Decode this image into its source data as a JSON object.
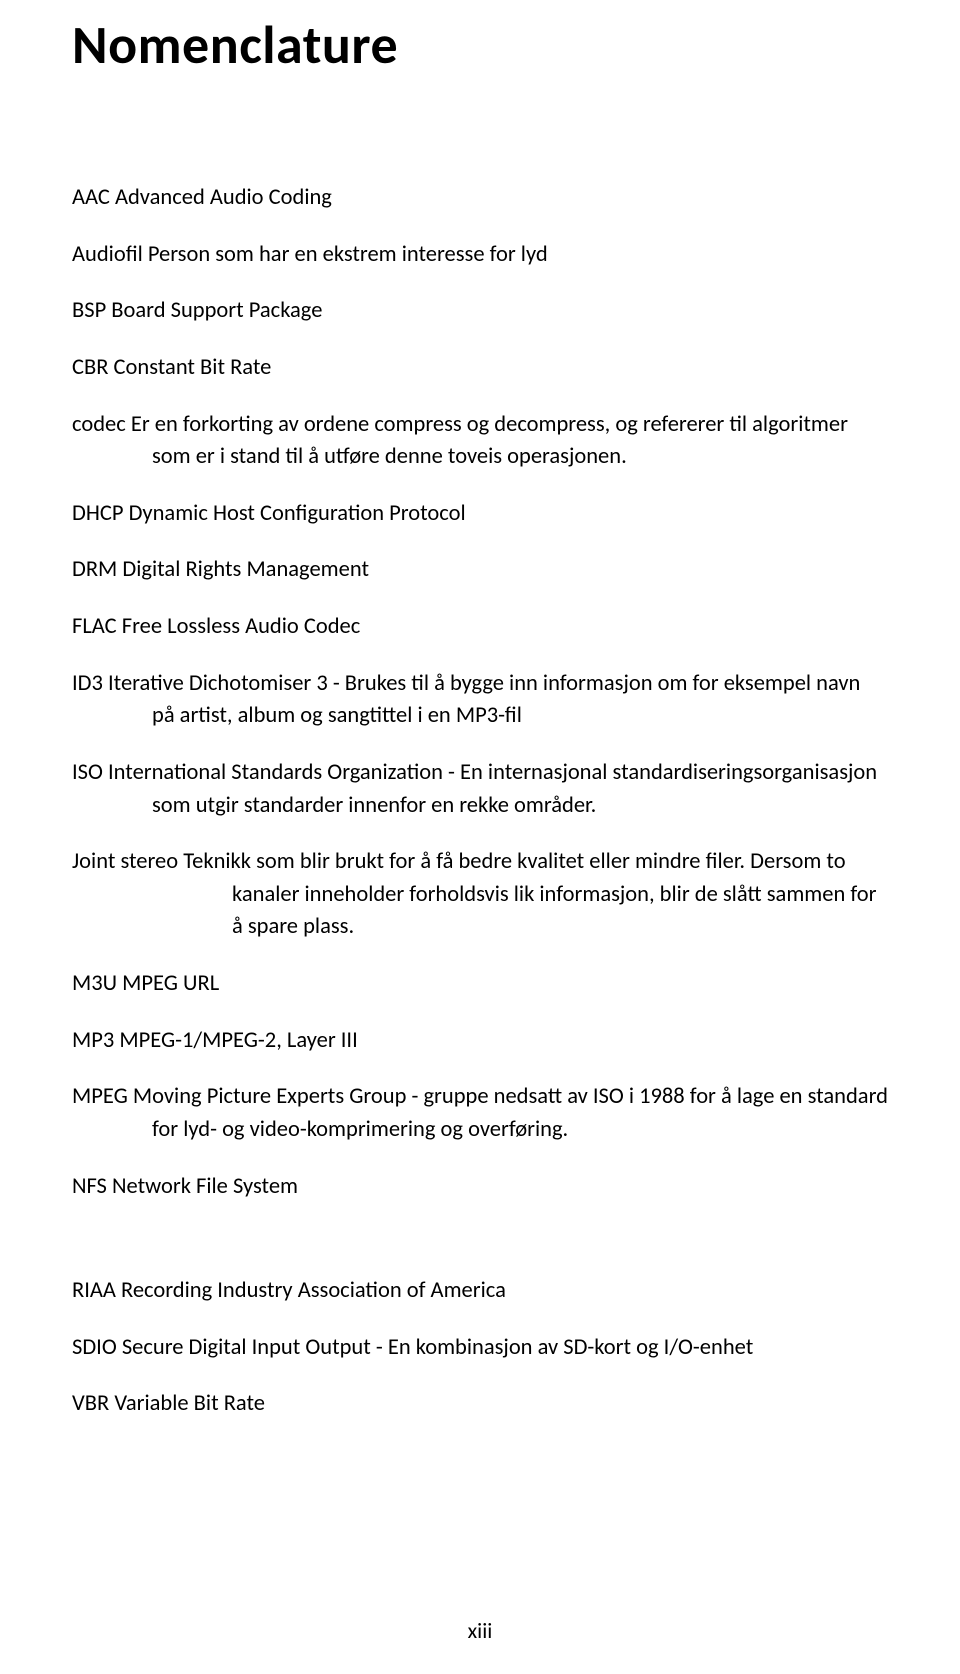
{
  "title": "Nomenclature",
  "page_number": "xiii",
  "entries": [
    {
      "term": "AAC",
      "sep": "   ",
      "def": "Advanced Audio Coding",
      "wide": false
    },
    {
      "term": "Audiofil",
      "sep": " ",
      "def": "Person som har en ekstrem interesse for lyd",
      "wide": true
    },
    {
      "term": "BSP",
      "sep": "   ",
      "def": "Board Support Package",
      "wide": false
    },
    {
      "term": "CBR",
      "sep": "   ",
      "def": "Constant Bit Rate",
      "wide": false
    },
    {
      "term": "codec",
      "sep": "  ",
      "def": "Er en forkorting av ordene compress og decompress, og refererer til algoritmer som er i stand til å utføre denne toveis operasjonen.",
      "wide": false
    },
    {
      "term": "DHCP",
      "sep": " ",
      "def": "Dynamic Host Configuration Protocol",
      "wide": false
    },
    {
      "term": "DRM",
      "sep": "   ",
      "def": "Digital Rights Management",
      "wide": false
    },
    {
      "term": "FLAC",
      "sep": "  ",
      "def": "Free Lossless Audio Codec",
      "wide": false
    },
    {
      "term": "ID3",
      "sep": "    ",
      "def": "Iterative Dichotomiser 3 - Brukes til å bygge inn informasjon om for eksempel navn på artist, album og sangtittel i en MP3-fil",
      "wide": false
    },
    {
      "term": "ISO",
      "sep": "    ",
      "def": "International Standards Organization - En internasjonal standardiseringsorganisasjon som utgir standarder innenfor en rekke områder.",
      "wide": false
    },
    {
      "term": "Joint stereo",
      "sep": " ",
      "def": "Teknikk som blir brukt for å få bedre kvalitet eller mindre filer. Dersom to kanaler inneholder forholdsvis lik informasjon, blir de slått sammen for å spare plass.",
      "wide": true,
      "xwide": true
    },
    {
      "term": "M3U",
      "sep": "   ",
      "def": "MPEG URL",
      "wide": false
    },
    {
      "term": "MP3",
      "sep": "   ",
      "def": "MPEG-1/MPEG-2, Layer III",
      "wide": false
    },
    {
      "term": "MPEG",
      "sep": " ",
      "def": "Moving Picture Experts Group - gruppe nedsatt av ISO i 1988 for å lage en standard for lyd- og video-komprimering og overføring.",
      "wide": false
    },
    {
      "term": "NFS",
      "sep": "    ",
      "def": "Network File System",
      "wide": false
    },
    {
      "term": "RIAA",
      "sep": "  ",
      "def": "Recording Industry Association of America",
      "wide": false,
      "gap": true
    },
    {
      "term": "SDIO",
      "sep": "  ",
      "def": "Secure Digital Input Output - En kombinasjon av SD-kort og I/O-enhet",
      "wide": false
    },
    {
      "term": "VBR",
      "sep": "   ",
      "def": "Variable Bit Rate",
      "wide": false
    }
  ]
}
